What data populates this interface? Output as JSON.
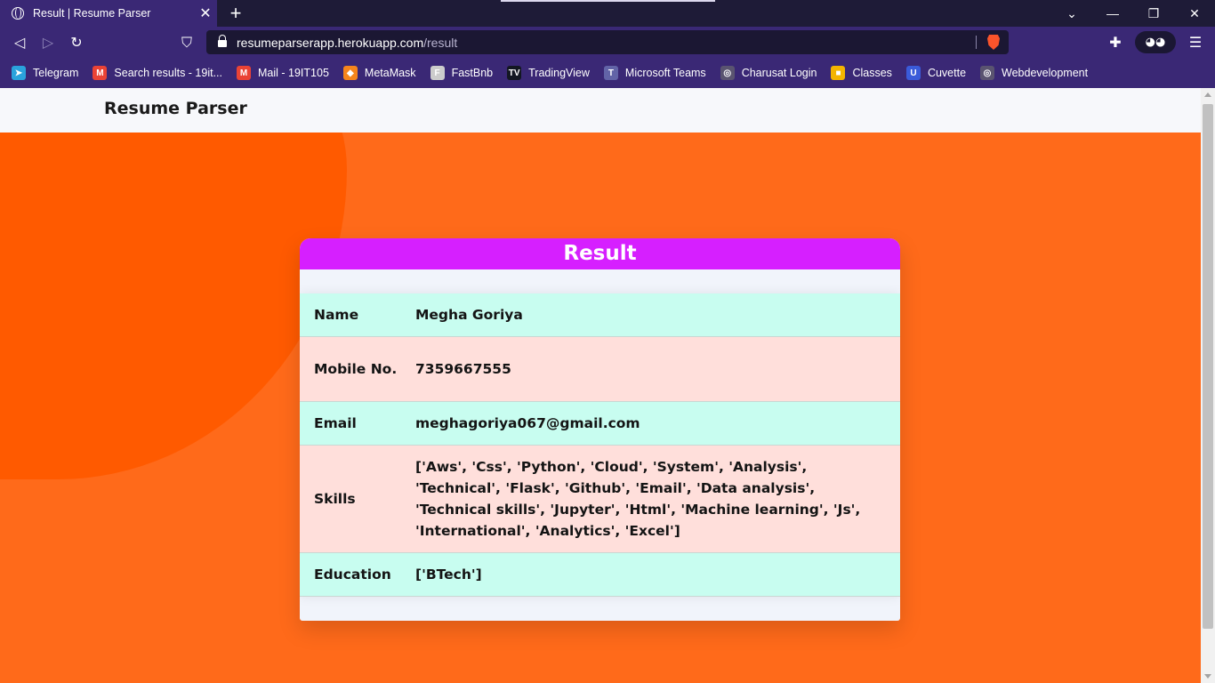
{
  "browser": {
    "tab_title": "Result | Resume Parser",
    "url_host": "resumeparserapp.herokuapp.com",
    "url_path": "/result",
    "bookmarks": [
      {
        "label": "Telegram",
        "icon": "telegram-icon",
        "color": "#2aa3dd",
        "glyph": "➤"
      },
      {
        "label": "Search results - 19it...",
        "icon": "gmail-icon",
        "color": "#ea4335",
        "glyph": "M"
      },
      {
        "label": "Mail - 19IT105",
        "icon": "gmail-icon",
        "color": "#ea4335",
        "glyph": "M"
      },
      {
        "label": "MetaMask",
        "icon": "metamask-icon",
        "color": "#f6851b",
        "glyph": "◆"
      },
      {
        "label": "FastBnb",
        "icon": "fastbnb-icon",
        "color": "#cccccc",
        "glyph": "F"
      },
      {
        "label": "TradingView",
        "icon": "tradingview-icon",
        "color": "#131722",
        "glyph": "TV"
      },
      {
        "label": "Microsoft Teams",
        "icon": "teams-icon",
        "color": "#6264a7",
        "glyph": "T"
      },
      {
        "label": "Charusat Login",
        "icon": "globe-icon",
        "color": "#5a5470",
        "glyph": "◎"
      },
      {
        "label": "Classes",
        "icon": "classroom-icon",
        "color": "#f4b400",
        "glyph": "■"
      },
      {
        "label": "Cuvette",
        "icon": "cuvette-icon",
        "color": "#3a5bd9",
        "glyph": "U"
      },
      {
        "label": "Webdevelopment",
        "icon": "globe-icon",
        "color": "#5a5470",
        "glyph": "◎"
      }
    ]
  },
  "app": {
    "brand": "Resume Parser"
  },
  "result": {
    "heading": "Result",
    "rows": [
      {
        "key": "Name",
        "value": "Megha Goriya"
      },
      {
        "key": "Mobile No.",
        "value": "7359667555"
      },
      {
        "key": "Email",
        "value": "meghagoriya067@gmail.com"
      },
      {
        "key": "Skills",
        "value": "['Aws', 'Css', 'Python', 'Cloud', 'System', 'Analysis', 'Technical', 'Flask', 'Github', 'Email', 'Data analysis', 'Technical skills', 'Jupyter', 'Html', 'Machine learning', 'Js', 'International', 'Analytics', 'Excel']"
      },
      {
        "key": "Education",
        "value": "['BTech']"
      }
    ]
  },
  "colors": {
    "page_bg": "#ff6a1a",
    "blob": "#ff5a00",
    "card_header": "#d61fff",
    "row_teal": "#c8fdf0",
    "row_pink": "#ffdfdb",
    "chrome": "#3a2875"
  }
}
